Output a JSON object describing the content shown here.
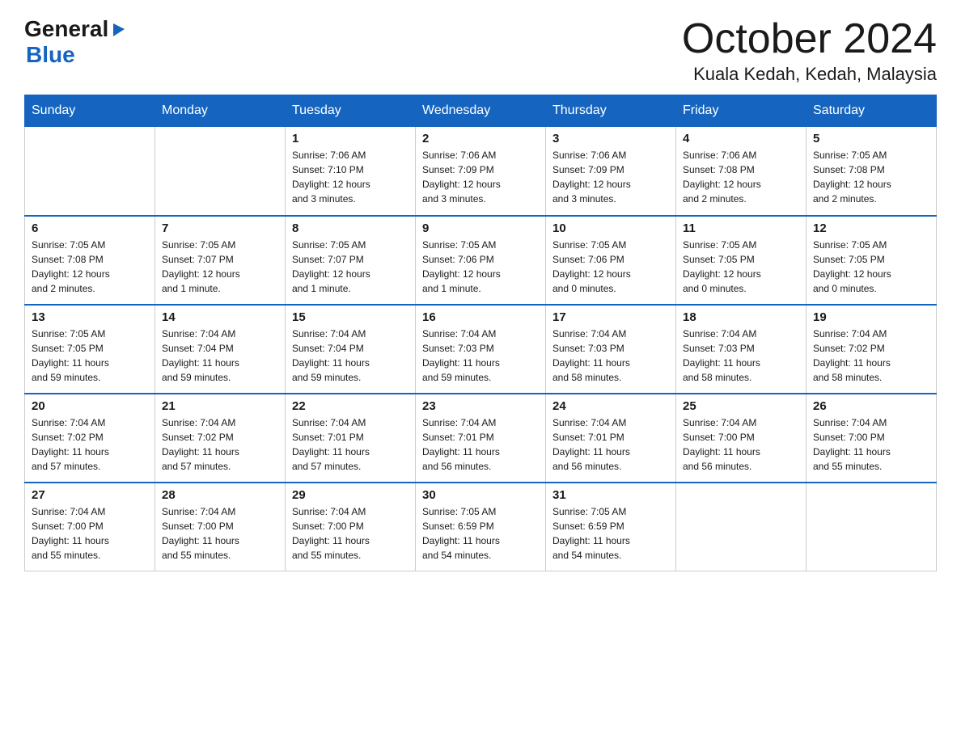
{
  "logo": {
    "general": "General",
    "blue": "Blue",
    "arrowSymbol": "▶"
  },
  "header": {
    "month_year": "October 2024",
    "location": "Kuala Kedah, Kedah, Malaysia"
  },
  "weekdays": [
    "Sunday",
    "Monday",
    "Tuesday",
    "Wednesday",
    "Thursday",
    "Friday",
    "Saturday"
  ],
  "weeks": [
    [
      {
        "day": "",
        "info": ""
      },
      {
        "day": "",
        "info": ""
      },
      {
        "day": "1",
        "info": "Sunrise: 7:06 AM\nSunset: 7:10 PM\nDaylight: 12 hours\nand 3 minutes."
      },
      {
        "day": "2",
        "info": "Sunrise: 7:06 AM\nSunset: 7:09 PM\nDaylight: 12 hours\nand 3 minutes."
      },
      {
        "day": "3",
        "info": "Sunrise: 7:06 AM\nSunset: 7:09 PM\nDaylight: 12 hours\nand 3 minutes."
      },
      {
        "day": "4",
        "info": "Sunrise: 7:06 AM\nSunset: 7:08 PM\nDaylight: 12 hours\nand 2 minutes."
      },
      {
        "day": "5",
        "info": "Sunrise: 7:05 AM\nSunset: 7:08 PM\nDaylight: 12 hours\nand 2 minutes."
      }
    ],
    [
      {
        "day": "6",
        "info": "Sunrise: 7:05 AM\nSunset: 7:08 PM\nDaylight: 12 hours\nand 2 minutes."
      },
      {
        "day": "7",
        "info": "Sunrise: 7:05 AM\nSunset: 7:07 PM\nDaylight: 12 hours\nand 1 minute."
      },
      {
        "day": "8",
        "info": "Sunrise: 7:05 AM\nSunset: 7:07 PM\nDaylight: 12 hours\nand 1 minute."
      },
      {
        "day": "9",
        "info": "Sunrise: 7:05 AM\nSunset: 7:06 PM\nDaylight: 12 hours\nand 1 minute."
      },
      {
        "day": "10",
        "info": "Sunrise: 7:05 AM\nSunset: 7:06 PM\nDaylight: 12 hours\nand 0 minutes."
      },
      {
        "day": "11",
        "info": "Sunrise: 7:05 AM\nSunset: 7:05 PM\nDaylight: 12 hours\nand 0 minutes."
      },
      {
        "day": "12",
        "info": "Sunrise: 7:05 AM\nSunset: 7:05 PM\nDaylight: 12 hours\nand 0 minutes."
      }
    ],
    [
      {
        "day": "13",
        "info": "Sunrise: 7:05 AM\nSunset: 7:05 PM\nDaylight: 11 hours\nand 59 minutes."
      },
      {
        "day": "14",
        "info": "Sunrise: 7:04 AM\nSunset: 7:04 PM\nDaylight: 11 hours\nand 59 minutes."
      },
      {
        "day": "15",
        "info": "Sunrise: 7:04 AM\nSunset: 7:04 PM\nDaylight: 11 hours\nand 59 minutes."
      },
      {
        "day": "16",
        "info": "Sunrise: 7:04 AM\nSunset: 7:03 PM\nDaylight: 11 hours\nand 59 minutes."
      },
      {
        "day": "17",
        "info": "Sunrise: 7:04 AM\nSunset: 7:03 PM\nDaylight: 11 hours\nand 58 minutes."
      },
      {
        "day": "18",
        "info": "Sunrise: 7:04 AM\nSunset: 7:03 PM\nDaylight: 11 hours\nand 58 minutes."
      },
      {
        "day": "19",
        "info": "Sunrise: 7:04 AM\nSunset: 7:02 PM\nDaylight: 11 hours\nand 58 minutes."
      }
    ],
    [
      {
        "day": "20",
        "info": "Sunrise: 7:04 AM\nSunset: 7:02 PM\nDaylight: 11 hours\nand 57 minutes."
      },
      {
        "day": "21",
        "info": "Sunrise: 7:04 AM\nSunset: 7:02 PM\nDaylight: 11 hours\nand 57 minutes."
      },
      {
        "day": "22",
        "info": "Sunrise: 7:04 AM\nSunset: 7:01 PM\nDaylight: 11 hours\nand 57 minutes."
      },
      {
        "day": "23",
        "info": "Sunrise: 7:04 AM\nSunset: 7:01 PM\nDaylight: 11 hours\nand 56 minutes."
      },
      {
        "day": "24",
        "info": "Sunrise: 7:04 AM\nSunset: 7:01 PM\nDaylight: 11 hours\nand 56 minutes."
      },
      {
        "day": "25",
        "info": "Sunrise: 7:04 AM\nSunset: 7:00 PM\nDaylight: 11 hours\nand 56 minutes."
      },
      {
        "day": "26",
        "info": "Sunrise: 7:04 AM\nSunset: 7:00 PM\nDaylight: 11 hours\nand 55 minutes."
      }
    ],
    [
      {
        "day": "27",
        "info": "Sunrise: 7:04 AM\nSunset: 7:00 PM\nDaylight: 11 hours\nand 55 minutes."
      },
      {
        "day": "28",
        "info": "Sunrise: 7:04 AM\nSunset: 7:00 PM\nDaylight: 11 hours\nand 55 minutes."
      },
      {
        "day": "29",
        "info": "Sunrise: 7:04 AM\nSunset: 7:00 PM\nDaylight: 11 hours\nand 55 minutes."
      },
      {
        "day": "30",
        "info": "Sunrise: 7:05 AM\nSunset: 6:59 PM\nDaylight: 11 hours\nand 54 minutes."
      },
      {
        "day": "31",
        "info": "Sunrise: 7:05 AM\nSunset: 6:59 PM\nDaylight: 11 hours\nand 54 minutes."
      },
      {
        "day": "",
        "info": ""
      },
      {
        "day": "",
        "info": ""
      }
    ]
  ]
}
